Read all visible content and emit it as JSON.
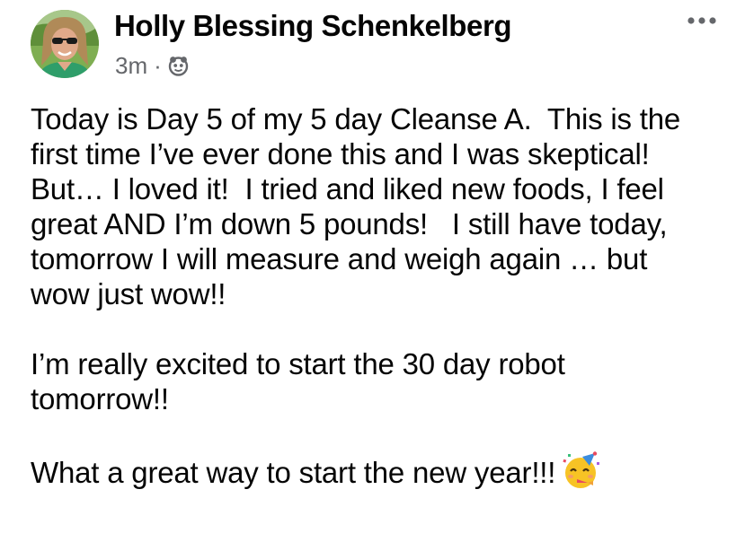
{
  "post": {
    "author_name": "Holly Blessing Schenkelberg",
    "timestamp": "3m",
    "separator": "·",
    "audience_icon": "friends-icon",
    "more_icon": "more-options-icon",
    "paragraphs": [
      "Today is Day 5 of my 5 day Cleanse A.  This is the\nfirst time I’ve ever done this and I was skeptical!\nBut… I loved it!  I tried and liked new foods, I feel\ngreat AND I’m down 5 pounds!   I still have today,\ntomorrow I will measure and weigh again … but\nwow just wow!!",
      "I’m really excited to start the 30 day robot\ntomorrow!!",
      "What a great way to start the new year!!!"
    ],
    "closing_emoji": "partying-face-emoji"
  }
}
